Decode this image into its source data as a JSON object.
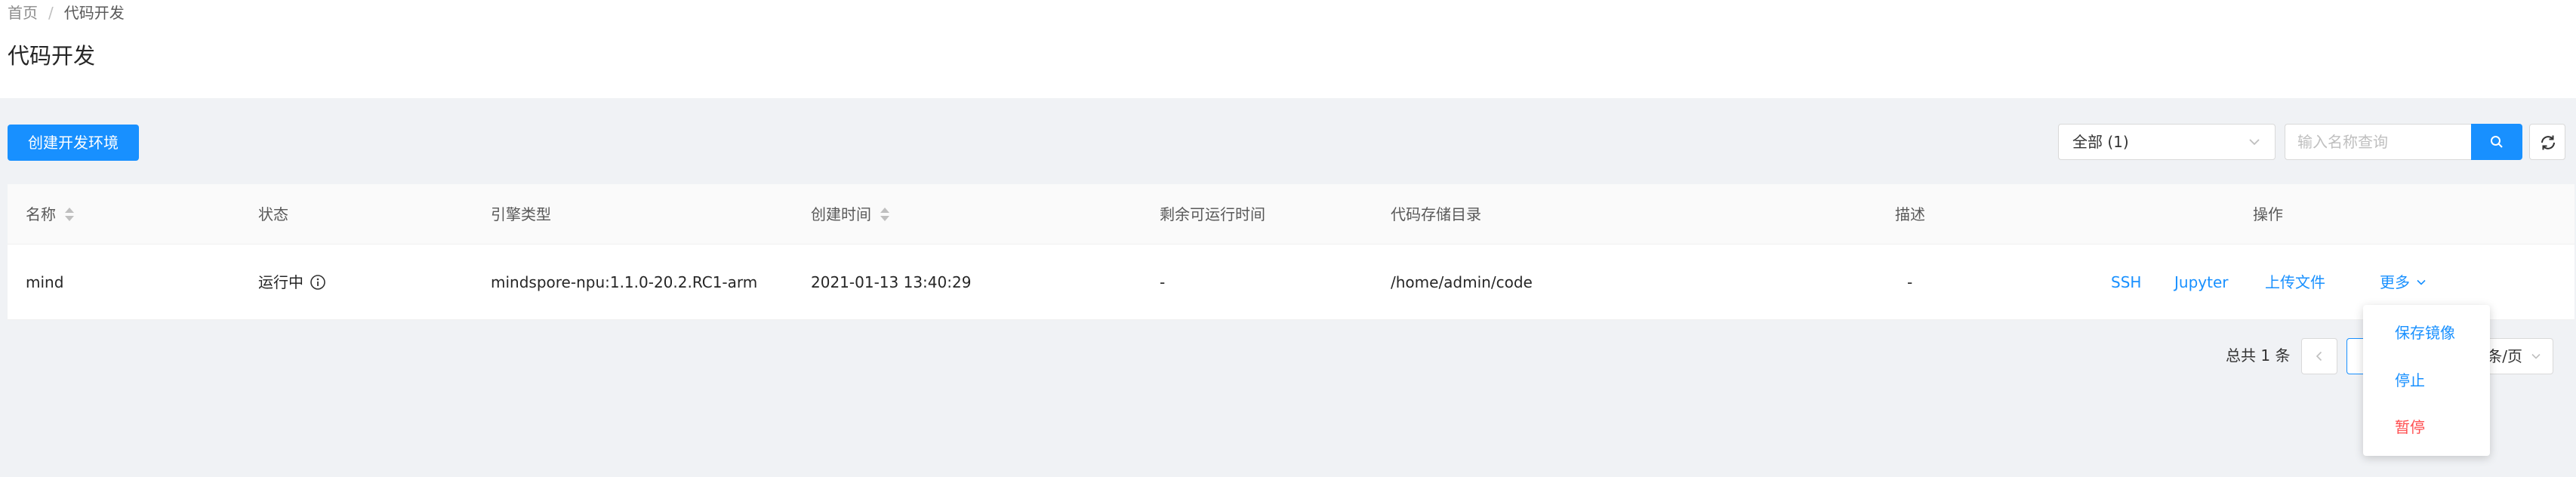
{
  "breadcrumb": {
    "home": "首页",
    "separator": "/",
    "current": "代码开发"
  },
  "page_title": "代码开发",
  "toolbar": {
    "create_button": "创建开发环境",
    "filter_value": "全部 (1)",
    "search_placeholder": "输入名称查询"
  },
  "table": {
    "columns": {
      "name": "名称",
      "status": "状态",
      "engine": "引擎类型",
      "created": "创建时间",
      "remaining": "剩余可运行时间",
      "code_dir": "代码存储目录",
      "desc": "描述",
      "actions": "操作"
    },
    "rows": [
      {
        "name": "mind",
        "status": "运行中",
        "engine": "mindspore-npu:1.1.0-20.2.RC1-arm",
        "created": "2021-01-13 13:40:29",
        "remaining": "-",
        "code_dir": "/home/admin/code",
        "desc": "-",
        "actions": {
          "ssh": "SSH",
          "jupyter": "Jupyter",
          "upload": "上传文件",
          "more": "更多"
        }
      }
    ]
  },
  "pagination": {
    "total": "总共 1 条",
    "page_size_suffix": "条/页"
  },
  "more_menu": {
    "save_image": "保存镜像",
    "stop": "停止",
    "pause": "暂停"
  },
  "colors": {
    "primary": "#1890ff",
    "danger": "#ff4d4f",
    "background": "#f0f2f5"
  }
}
